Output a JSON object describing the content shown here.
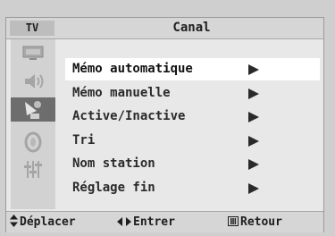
{
  "header": {
    "tv_label": "TV",
    "title": "Canal"
  },
  "sidebar": {
    "icons": [
      {
        "name": "picture-icon",
        "selected": false
      },
      {
        "name": "sound-icon",
        "selected": false
      },
      {
        "name": "channel-antenna-icon",
        "selected": true
      },
      {
        "name": "timer-icon",
        "selected": false
      },
      {
        "name": "setup-sliders-icon",
        "selected": false
      }
    ]
  },
  "menu": {
    "items": [
      {
        "label": "Mémo automatique",
        "selected": true
      },
      {
        "label": "Mémo manuelle",
        "selected": false
      },
      {
        "label": "Active/Inactive",
        "selected": false
      },
      {
        "label": "Tri",
        "selected": false
      },
      {
        "label": "Nom station",
        "selected": false
      },
      {
        "label": "Réglage fin",
        "selected": false
      }
    ]
  },
  "footer": {
    "move_label": "Déplacer",
    "enter_label": "Entrer",
    "return_label": "Retour"
  },
  "colors": {
    "osd_background": "#e8e8e8",
    "selected_row": "#ffffff",
    "selected_icon": "#6d6d6d",
    "text": "#1e1e1e"
  }
}
